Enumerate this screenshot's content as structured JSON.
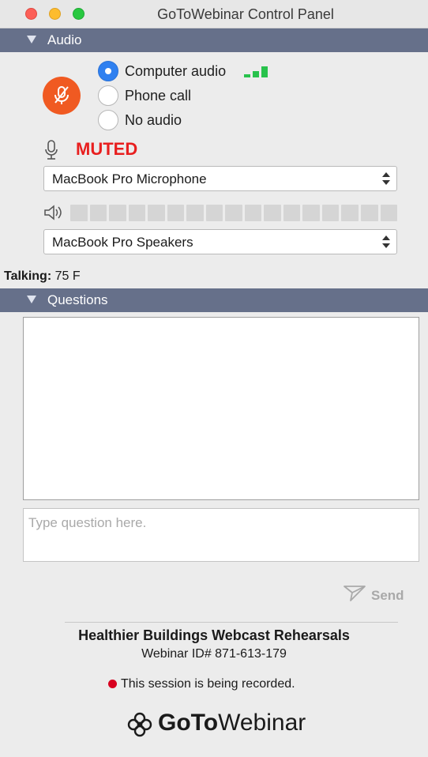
{
  "window": {
    "title": "GoToWebinar Control Panel"
  },
  "audio": {
    "section_label": "Audio",
    "options": [
      {
        "label": "Computer audio",
        "selected": true
      },
      {
        "label": "Phone call",
        "selected": false
      },
      {
        "label": "No audio",
        "selected": false
      }
    ],
    "status_text": "MUTED",
    "microphone": {
      "selected": "MacBook Pro Microphone"
    },
    "speakers": {
      "selected": "MacBook Pro Speakers"
    },
    "signal_strength_bars": 3,
    "speaker_level": 0,
    "level_segments": 17,
    "colors": {
      "accent": "#2f80f0",
      "mute_button": "#f05a22",
      "muted_text": "#e81f1f",
      "signal": "#28c24c",
      "header": "#66708a"
    }
  },
  "talking": {
    "label": "Talking:",
    "value": "75 F"
  },
  "questions": {
    "section_label": "Questions",
    "input_placeholder": "Type question here.",
    "send_label": "Send"
  },
  "webinar": {
    "title": "Healthier Buildings Webcast Rehearsals",
    "id_text": "Webinar ID# 871-613-179",
    "recording_text": "This session is being recorded."
  },
  "brand": {
    "logo_bold": "GoTo",
    "logo_light": "Webinar"
  },
  "icons": {
    "mute": "microphone-muted-icon",
    "mic": "microphone-icon",
    "speaker": "speaker-icon",
    "send": "paper-plane-icon",
    "select_arrows": "up-down-chevron-icon",
    "logo": "gotowebinar-flower-icon"
  }
}
